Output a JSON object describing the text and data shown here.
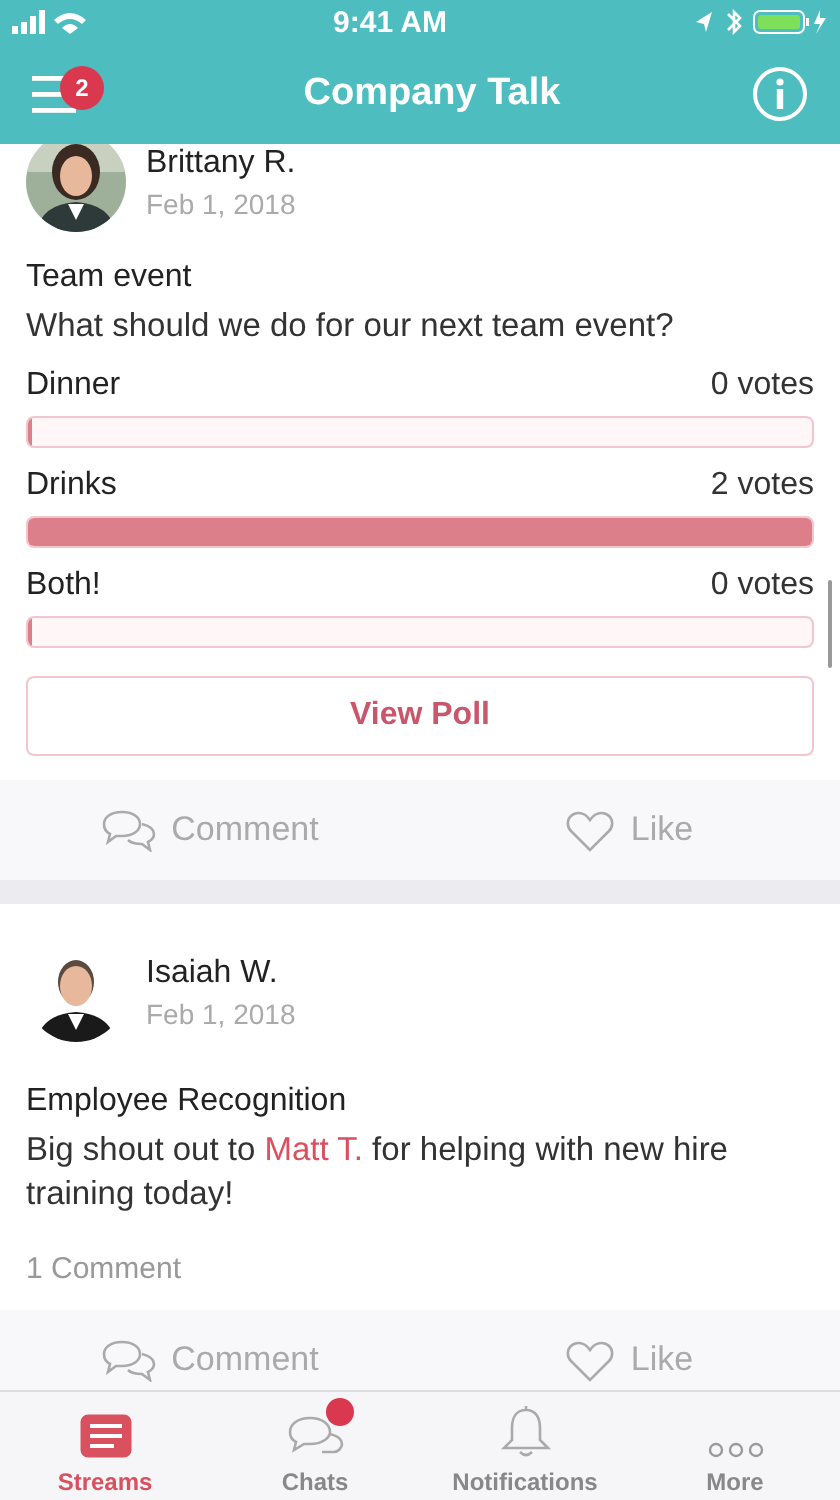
{
  "status_bar": {
    "time": "9:41 AM"
  },
  "header": {
    "title": "Company Talk",
    "menu_badge": "2"
  },
  "posts": [
    {
      "kind": "poll",
      "author": "Brittany R.",
      "date": "Feb 1, 2018",
      "title": "Team event",
      "text": "What should we do for our next team event?",
      "options": [
        {
          "label": "Dinner",
          "votes": "0 votes",
          "level": 0
        },
        {
          "label": "Drinks",
          "votes": "2 votes",
          "level": 1
        },
        {
          "label": "Both!",
          "votes": "0 votes",
          "level": 0
        }
      ],
      "button": "View Poll",
      "actions": [
        "Comment",
        "Like"
      ]
    },
    {
      "kind": "text",
      "author": "Isaiah W.",
      "date": "Feb 1, 2018",
      "title": "Employee Recognition",
      "text": "Big shout out to **Matt T.** for helping with new hire training today!",
      "comments": "1 Comment",
      "actions": [
        "Comment",
        "Like"
      ]
    }
  ],
  "tabs": [
    {
      "label": "Streams",
      "selected": true,
      "badge": false
    },
    {
      "label": "Chats",
      "selected": false,
      "badge": true
    },
    {
      "label": "Notifications",
      "selected": false,
      "badge": false
    },
    {
      "label": "More",
      "selected": false,
      "badge": false
    }
  ]
}
